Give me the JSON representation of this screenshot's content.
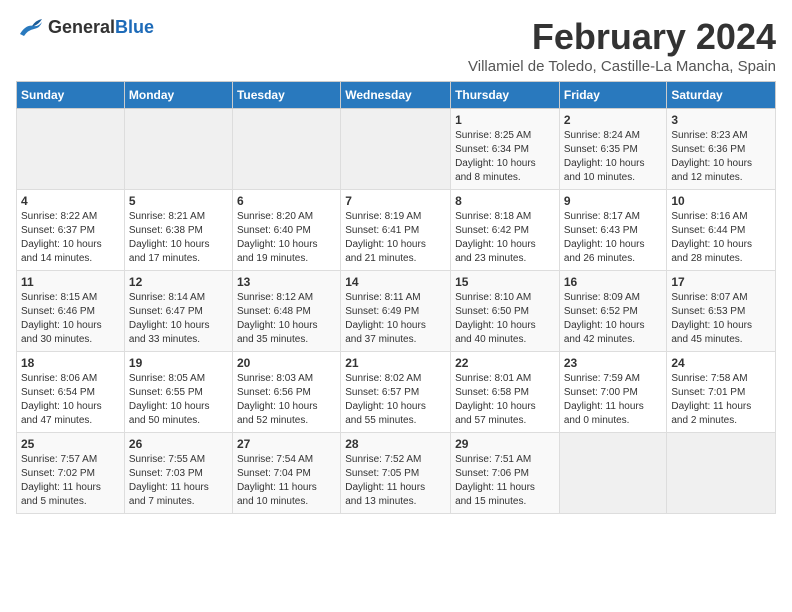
{
  "header": {
    "logo_general": "General",
    "logo_blue": "Blue",
    "month_title": "February 2024",
    "location": "Villamiel de Toledo, Castille-La Mancha, Spain"
  },
  "days_of_week": [
    "Sunday",
    "Monday",
    "Tuesday",
    "Wednesday",
    "Thursday",
    "Friday",
    "Saturday"
  ],
  "weeks": [
    [
      {
        "day": "",
        "info": ""
      },
      {
        "day": "",
        "info": ""
      },
      {
        "day": "",
        "info": ""
      },
      {
        "day": "",
        "info": ""
      },
      {
        "day": "1",
        "info": "Sunrise: 8:25 AM\nSunset: 6:34 PM\nDaylight: 10 hours\nand 8 minutes."
      },
      {
        "day": "2",
        "info": "Sunrise: 8:24 AM\nSunset: 6:35 PM\nDaylight: 10 hours\nand 10 minutes."
      },
      {
        "day": "3",
        "info": "Sunrise: 8:23 AM\nSunset: 6:36 PM\nDaylight: 10 hours\nand 12 minutes."
      }
    ],
    [
      {
        "day": "4",
        "info": "Sunrise: 8:22 AM\nSunset: 6:37 PM\nDaylight: 10 hours\nand 14 minutes."
      },
      {
        "day": "5",
        "info": "Sunrise: 8:21 AM\nSunset: 6:38 PM\nDaylight: 10 hours\nand 17 minutes."
      },
      {
        "day": "6",
        "info": "Sunrise: 8:20 AM\nSunset: 6:40 PM\nDaylight: 10 hours\nand 19 minutes."
      },
      {
        "day": "7",
        "info": "Sunrise: 8:19 AM\nSunset: 6:41 PM\nDaylight: 10 hours\nand 21 minutes."
      },
      {
        "day": "8",
        "info": "Sunrise: 8:18 AM\nSunset: 6:42 PM\nDaylight: 10 hours\nand 23 minutes."
      },
      {
        "day": "9",
        "info": "Sunrise: 8:17 AM\nSunset: 6:43 PM\nDaylight: 10 hours\nand 26 minutes."
      },
      {
        "day": "10",
        "info": "Sunrise: 8:16 AM\nSunset: 6:44 PM\nDaylight: 10 hours\nand 28 minutes."
      }
    ],
    [
      {
        "day": "11",
        "info": "Sunrise: 8:15 AM\nSunset: 6:46 PM\nDaylight: 10 hours\nand 30 minutes."
      },
      {
        "day": "12",
        "info": "Sunrise: 8:14 AM\nSunset: 6:47 PM\nDaylight: 10 hours\nand 33 minutes."
      },
      {
        "day": "13",
        "info": "Sunrise: 8:12 AM\nSunset: 6:48 PM\nDaylight: 10 hours\nand 35 minutes."
      },
      {
        "day": "14",
        "info": "Sunrise: 8:11 AM\nSunset: 6:49 PM\nDaylight: 10 hours\nand 37 minutes."
      },
      {
        "day": "15",
        "info": "Sunrise: 8:10 AM\nSunset: 6:50 PM\nDaylight: 10 hours\nand 40 minutes."
      },
      {
        "day": "16",
        "info": "Sunrise: 8:09 AM\nSunset: 6:52 PM\nDaylight: 10 hours\nand 42 minutes."
      },
      {
        "day": "17",
        "info": "Sunrise: 8:07 AM\nSunset: 6:53 PM\nDaylight: 10 hours\nand 45 minutes."
      }
    ],
    [
      {
        "day": "18",
        "info": "Sunrise: 8:06 AM\nSunset: 6:54 PM\nDaylight: 10 hours\nand 47 minutes."
      },
      {
        "day": "19",
        "info": "Sunrise: 8:05 AM\nSunset: 6:55 PM\nDaylight: 10 hours\nand 50 minutes."
      },
      {
        "day": "20",
        "info": "Sunrise: 8:03 AM\nSunset: 6:56 PM\nDaylight: 10 hours\nand 52 minutes."
      },
      {
        "day": "21",
        "info": "Sunrise: 8:02 AM\nSunset: 6:57 PM\nDaylight: 10 hours\nand 55 minutes."
      },
      {
        "day": "22",
        "info": "Sunrise: 8:01 AM\nSunset: 6:58 PM\nDaylight: 10 hours\nand 57 minutes."
      },
      {
        "day": "23",
        "info": "Sunrise: 7:59 AM\nSunset: 7:00 PM\nDaylight: 11 hours\nand 0 minutes."
      },
      {
        "day": "24",
        "info": "Sunrise: 7:58 AM\nSunset: 7:01 PM\nDaylight: 11 hours\nand 2 minutes."
      }
    ],
    [
      {
        "day": "25",
        "info": "Sunrise: 7:57 AM\nSunset: 7:02 PM\nDaylight: 11 hours\nand 5 minutes."
      },
      {
        "day": "26",
        "info": "Sunrise: 7:55 AM\nSunset: 7:03 PM\nDaylight: 11 hours\nand 7 minutes."
      },
      {
        "day": "27",
        "info": "Sunrise: 7:54 AM\nSunset: 7:04 PM\nDaylight: 11 hours\nand 10 minutes."
      },
      {
        "day": "28",
        "info": "Sunrise: 7:52 AM\nSunset: 7:05 PM\nDaylight: 11 hours\nand 13 minutes."
      },
      {
        "day": "29",
        "info": "Sunrise: 7:51 AM\nSunset: 7:06 PM\nDaylight: 11 hours\nand 15 minutes."
      },
      {
        "day": "",
        "info": ""
      },
      {
        "day": "",
        "info": ""
      }
    ]
  ]
}
